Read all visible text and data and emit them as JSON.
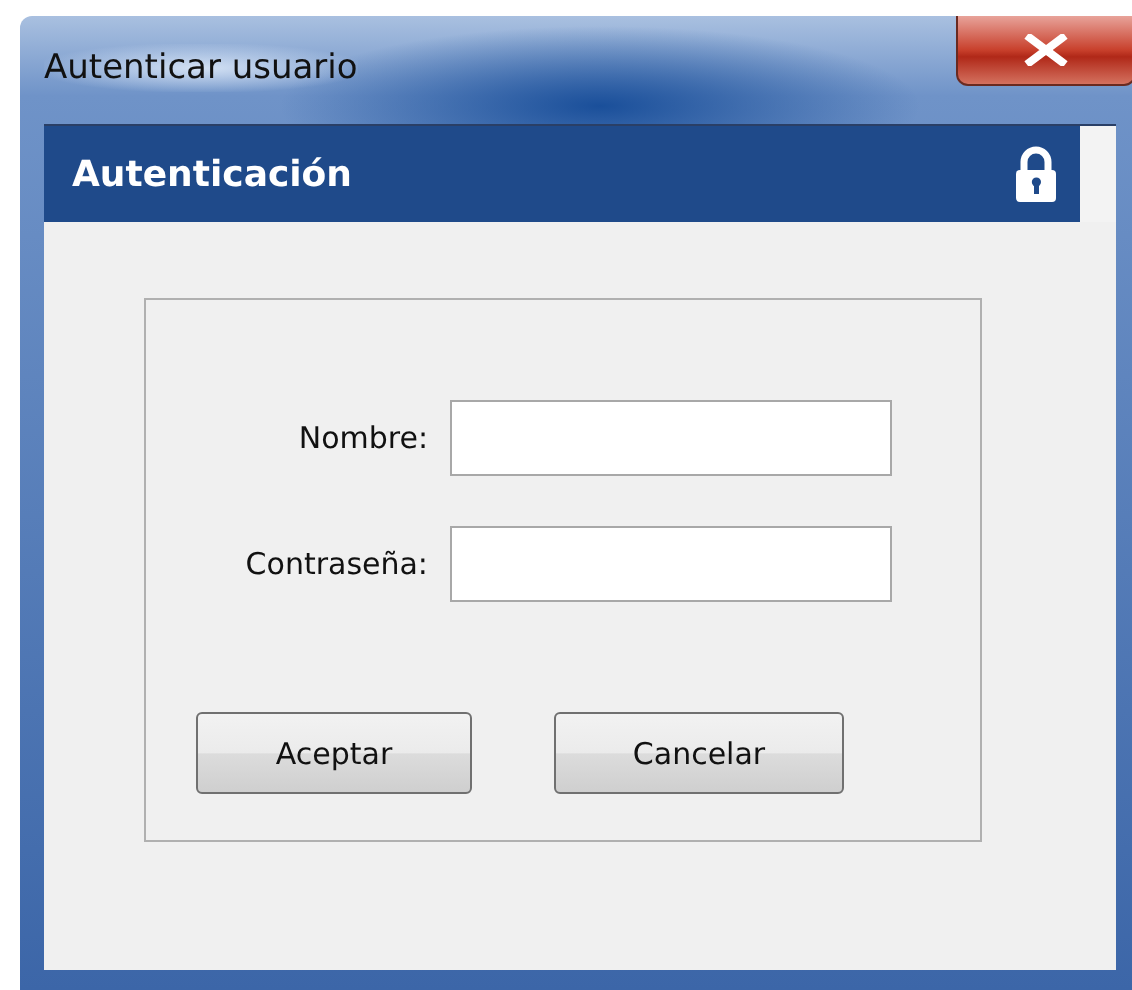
{
  "window": {
    "title": "Autenticar usuario"
  },
  "header": {
    "title": "Autenticación"
  },
  "fields": [
    {
      "label": "Nombre:"
    },
    {
      "label": "Contraseña:"
    }
  ],
  "buttons": [
    "Aceptar",
    "Cancelar"
  ]
}
